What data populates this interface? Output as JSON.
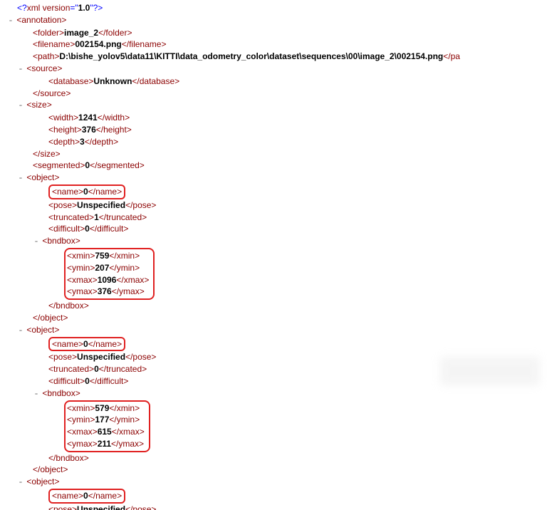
{
  "xml_decl": {
    "open": "<?",
    "name": "xml version",
    "eq": "=",
    "q1": "\"",
    "ver": "1.0",
    "q2": "\"",
    "close": "?>"
  },
  "tags": {
    "annotation_open": "<annotation>",
    "folder_open": "<folder>",
    "folder_close": "</folder>",
    "filename_open": "<filename>",
    "filename_close": "</filename>",
    "path_open": "<path>",
    "path_close_trunc": "</pa",
    "source_open": "<source>",
    "source_close": "</source>",
    "database_open": "<database>",
    "database_close": "</database>",
    "size_open": "<size>",
    "size_close": "</size>",
    "width_open": "<width>",
    "width_close": "</width>",
    "height_open": "<height>",
    "height_close": "</height>",
    "depth_open": "<depth>",
    "depth_close": "</depth>",
    "segmented_open": "<segmented>",
    "segmented_close": "</segmented>",
    "object_open": "<object>",
    "object_close": "</object>",
    "name_open": "<name>",
    "name_close": "</name>",
    "pose_open": "<pose>",
    "pose_close": "</pose>",
    "truncated_open": "<truncated>",
    "truncated_close": "</truncated>",
    "difficult_open": "<difficult>",
    "difficult_close": "</difficult>",
    "bndbox_open": "<bndbox>",
    "bndbox_close_hidden": "</bndbox>",
    "xmin_open": "<xmin>",
    "xmin_close": "</xmin>",
    "ymin_open": "<ymin>",
    "ymin_close": "</ymin>",
    "xmax_open": "<xmax>",
    "xmax_close": "</xmax>",
    "ymax_open": "<ymax>",
    "ymax_close": "</ymax>"
  },
  "values": {
    "folder": "image_2",
    "filename": "002154.png",
    "path": "D:\\bishe_yolov5\\data11\\KITTI\\data_odometry_color\\dataset\\sequences\\00\\image_2\\002154.png",
    "database": "Unknown",
    "width": "1241",
    "height": "376",
    "depth": "3",
    "segmented": "0",
    "obj1": {
      "name": "0",
      "pose": "Unspecified",
      "truncated": "1",
      "difficult": "0",
      "xmin": "759",
      "ymin": "207",
      "xmax": "1096",
      "ymax": "376"
    },
    "obj2": {
      "name": "0",
      "pose": "Unspecified",
      "truncated": "0",
      "difficult": "0",
      "xmin": "579",
      "ymin": "177",
      "xmax": "615",
      "ymax": "211"
    },
    "obj3": {
      "name": "0",
      "pose": "Unspecified"
    }
  },
  "toggle": {
    "minus": "-"
  }
}
